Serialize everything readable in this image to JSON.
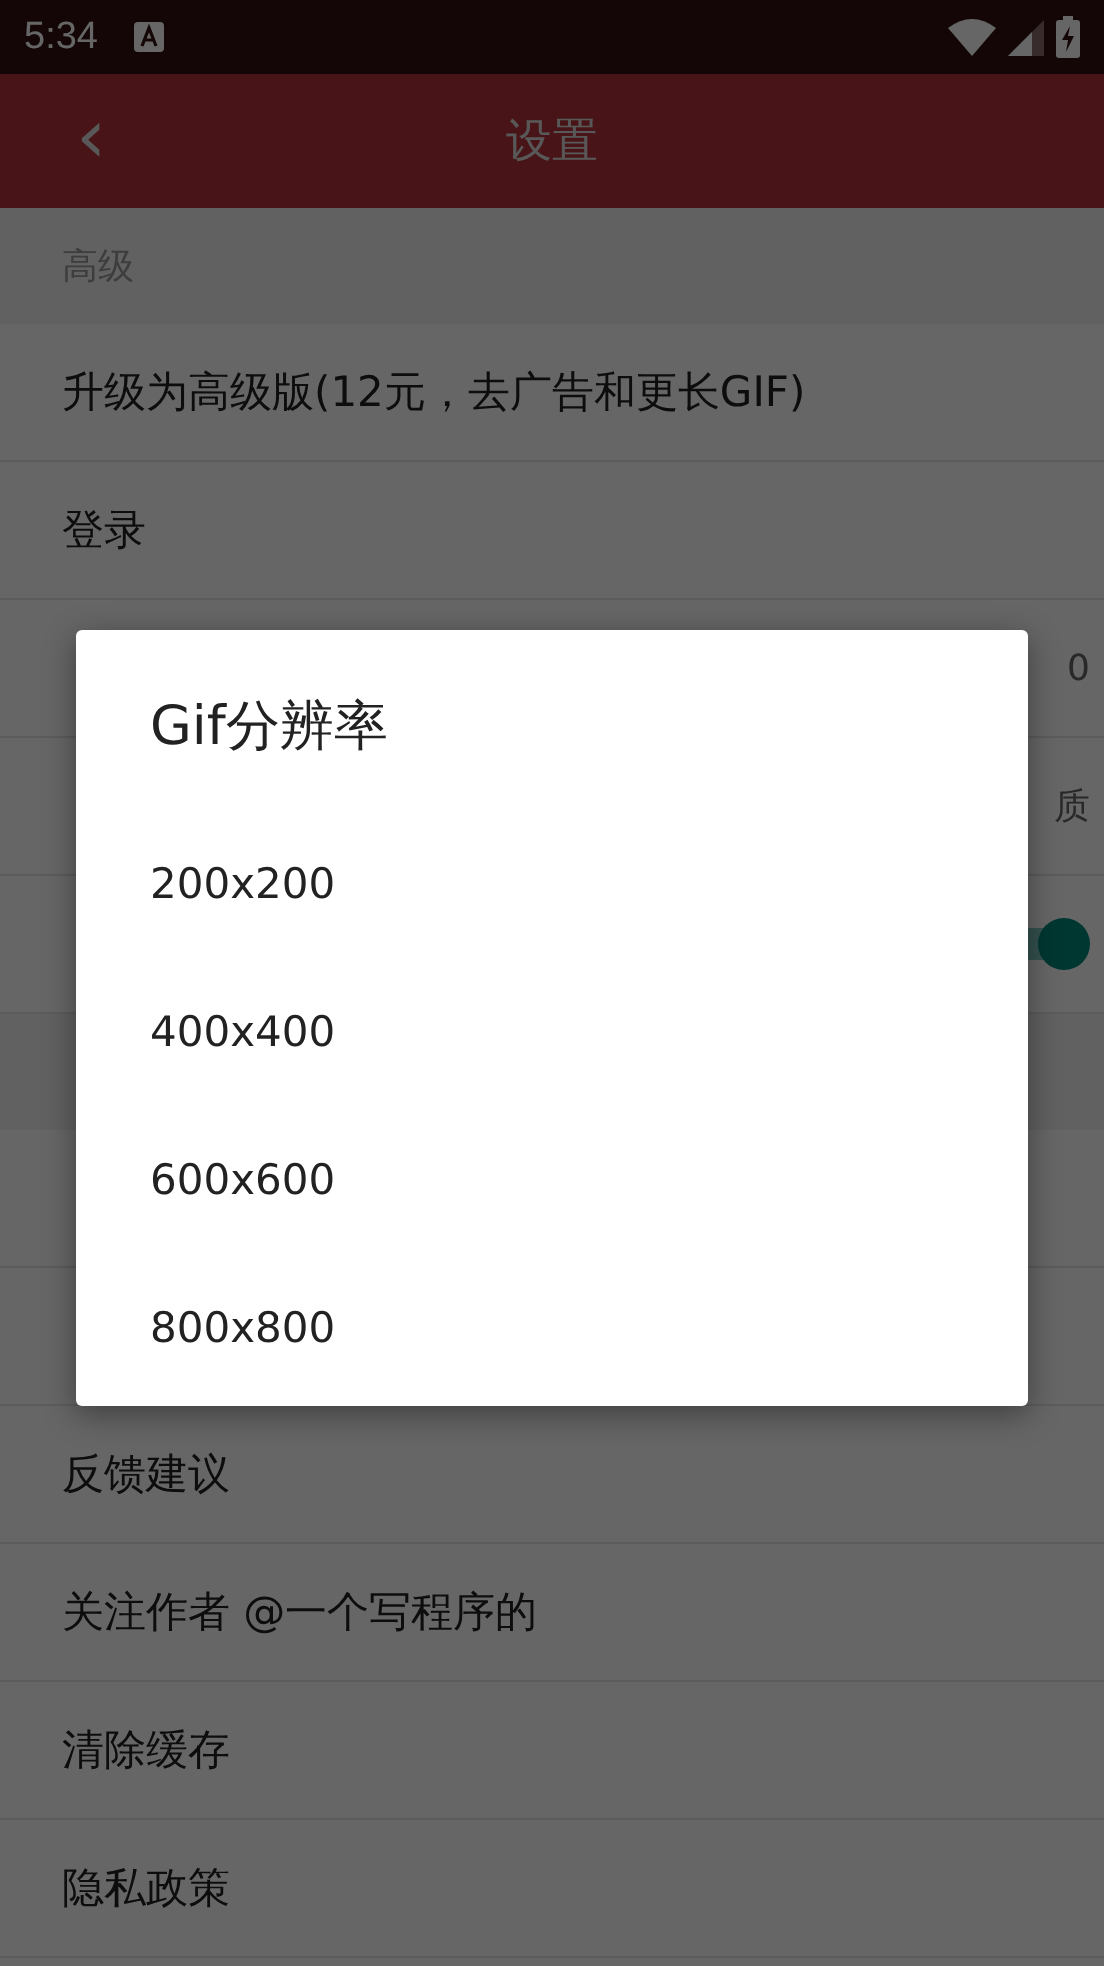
{
  "status_bar": {
    "time": "5:34"
  },
  "toolbar": {
    "back": "‹",
    "title": "设置"
  },
  "sections": [
    {
      "header": "高级",
      "rows": [
        {
          "label": "升级为高级版(12元，去广告和更长GIF)"
        },
        {
          "label": "登录"
        },
        {
          "value": "0"
        },
        {
          "value": "质"
        },
        {
          "kind": "switch",
          "on": true
        }
      ]
    },
    {
      "rows": [
        {},
        {},
        {
          "label": "反馈建议"
        },
        {
          "label": "关注作者 @一个写程序的"
        },
        {
          "label": "清除缓存"
        },
        {
          "label": "隐私政策"
        }
      ]
    }
  ],
  "dialog": {
    "title": "Gif分辨率",
    "options": [
      "200x200",
      "400x400",
      "600x600",
      "800x800"
    ]
  }
}
